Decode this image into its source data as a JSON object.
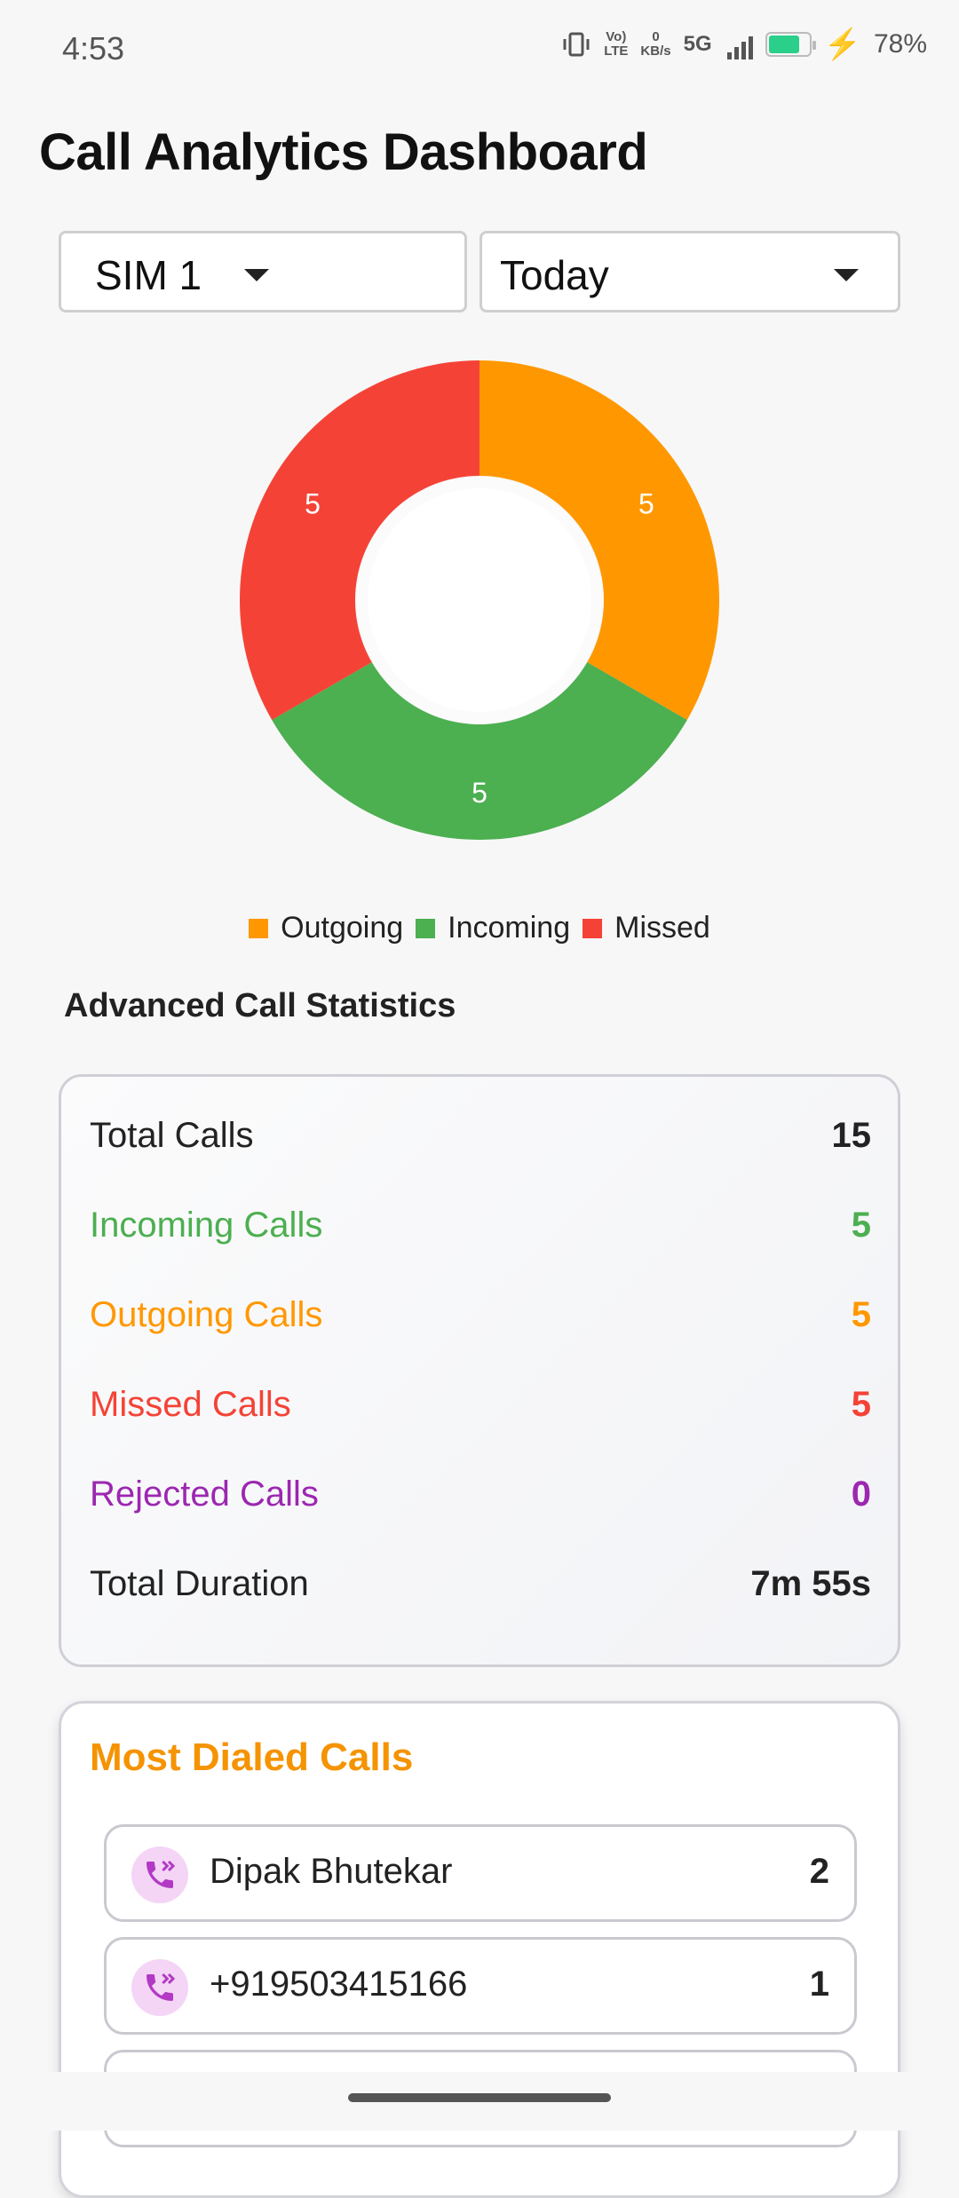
{
  "status_bar": {
    "time": "4:53",
    "volte_top": "Vo)",
    "volte_bottom": "LTE",
    "data_rate_top": "0",
    "data_rate_bottom": "KB/s",
    "network": "5G",
    "battery_percent": "78%",
    "battery_level": 0.78,
    "icons": [
      "vibrate-icon",
      "volte-icon",
      "signal-icon",
      "battery-icon",
      "charging-icon"
    ]
  },
  "header": {
    "title": "Call Analytics Dashboard"
  },
  "filters": {
    "sim": {
      "selected": "SIM 1"
    },
    "period": {
      "selected": "Today"
    }
  },
  "chart_data": {
    "type": "pie",
    "donut": true,
    "categories": [
      "Outgoing",
      "Incoming",
      "Missed"
    ],
    "values": [
      5,
      5,
      5
    ],
    "colors": [
      "#ff9800",
      "#4caf50",
      "#f44336"
    ],
    "legend": "bottom"
  },
  "stats": {
    "title": "Advanced Call Statistics",
    "rows": [
      {
        "label": "Total Calls",
        "value": "15",
        "color": "#222222"
      },
      {
        "label": "Incoming Calls",
        "value": "5",
        "color": "#4caf50"
      },
      {
        "label": "Outgoing Calls",
        "value": "5",
        "color": "#ff9800"
      },
      {
        "label": "Missed Calls",
        "value": "5",
        "color": "#f44336"
      },
      {
        "label": "Rejected Calls",
        "value": "0",
        "color": "#9c27b0"
      },
      {
        "label": "Total Duration",
        "value": "7m 55s",
        "color": "#222222"
      }
    ]
  },
  "most_dialed": {
    "title": "Most Dialed Calls",
    "items": [
      {
        "name": "Dipak Bhutekar",
        "count": "2"
      },
      {
        "name": "+919503415166",
        "count": "1"
      },
      {
        "name": "",
        "count": ""
      }
    ]
  }
}
